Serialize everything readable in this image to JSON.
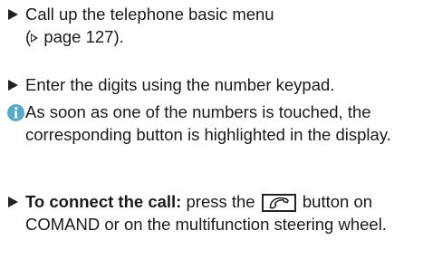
{
  "colors": {
    "text": "#1a1a1a",
    "info_icon": "#5aa8c8"
  },
  "icons": {
    "bullet": "arrow-bullet-icon",
    "note": "info-icon",
    "page_ref": "page-reference-icon",
    "call_button": "phone-call-button-icon"
  },
  "steps": [
    {
      "line1": "Call up the telephone basic menu",
      "line2_prefix": "(",
      "page_ref": "page 127",
      "line2_suffix": ")."
    },
    {
      "text": "Enter the digits using the number keypad."
    }
  ],
  "note": {
    "text": "As soon as one of the numbers is touched, the corresponding button is highlighted in the display."
  },
  "connect": {
    "bold": "To connect the call:",
    "before_button": " press the ",
    "after_button": " button on COMAND or on the multifunction steering wheel."
  }
}
